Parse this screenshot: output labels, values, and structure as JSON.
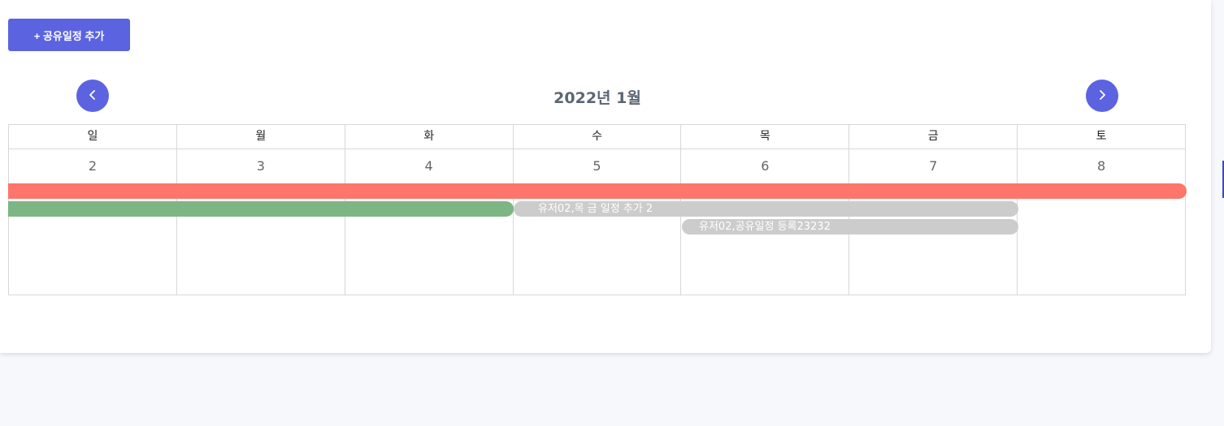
{
  "toolbar": {
    "add_label": "+ 공유일정 추가"
  },
  "calendar": {
    "title": "2022년 1월",
    "weekdays": [
      "일",
      "월",
      "화",
      "수",
      "목",
      "금",
      "토"
    ],
    "days": [
      "2",
      "3",
      "4",
      "5",
      "6",
      "7",
      "8"
    ],
    "prev_icon": "chevron-left-icon",
    "next_icon": "chevron-right-icon"
  },
  "events": [
    {
      "label": "",
      "color": "#fd756b",
      "start_day": "2",
      "end_day": "8"
    },
    {
      "label": "",
      "color": "#7db584",
      "start_day": "2",
      "end_day": "4"
    },
    {
      "label": "유저02,목 금 일정 추가 2",
      "color": "#cccccc",
      "start_day": "5",
      "end_day": "7"
    },
    {
      "label": "유저02,공유일정 등록23232",
      "color": "#cccccc",
      "start_day": "6",
      "end_day": "7"
    }
  ],
  "colors": {
    "accent": "#5c63e0",
    "title": "#5d6673"
  }
}
